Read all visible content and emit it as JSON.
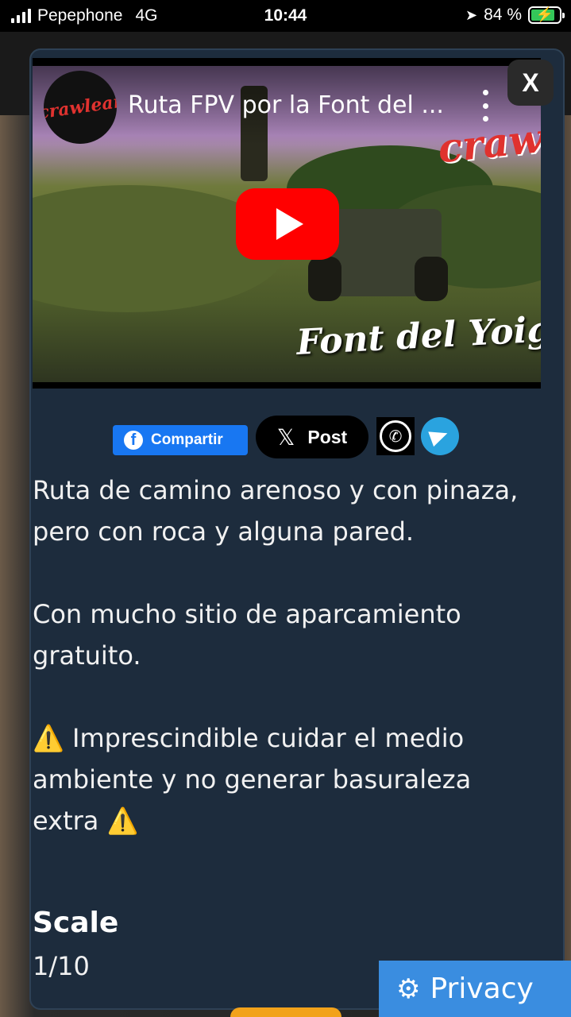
{
  "status_bar": {
    "carrier": "Pepephone",
    "network": "4G",
    "time": "10:44",
    "battery_percent": "84 %",
    "battery_level": 0.84
  },
  "video": {
    "title": "Ruta FPV por la Font del ...",
    "channel_logo_text": "crawlear",
    "watermark_brand": "crawlear",
    "watermark_caption": "Font del Yoig i Amig",
    "close_label": "X"
  },
  "share": {
    "facebook_label": "Compartir",
    "x_label": "Post"
  },
  "description": {
    "line1": "Ruta de camino arenoso y con pinaza, pero con roca y alguna pared.",
    "line2": "Con mucho sitio de aparcamiento gratuito.",
    "line3": "⚠️ Imprescindible cuidar el medio ambiente y no generar basuraleza extra ⚠️"
  },
  "scale": {
    "label": "Scale",
    "value": "1/10"
  },
  "privacy": {
    "label": "Privacy"
  },
  "colors": {
    "modal_bg": "#1d2c3d",
    "youtube_red": "#ff0000",
    "facebook_blue": "#1877f2",
    "telegram_blue": "#2aa3df",
    "privacy_blue": "#3a8de0"
  }
}
